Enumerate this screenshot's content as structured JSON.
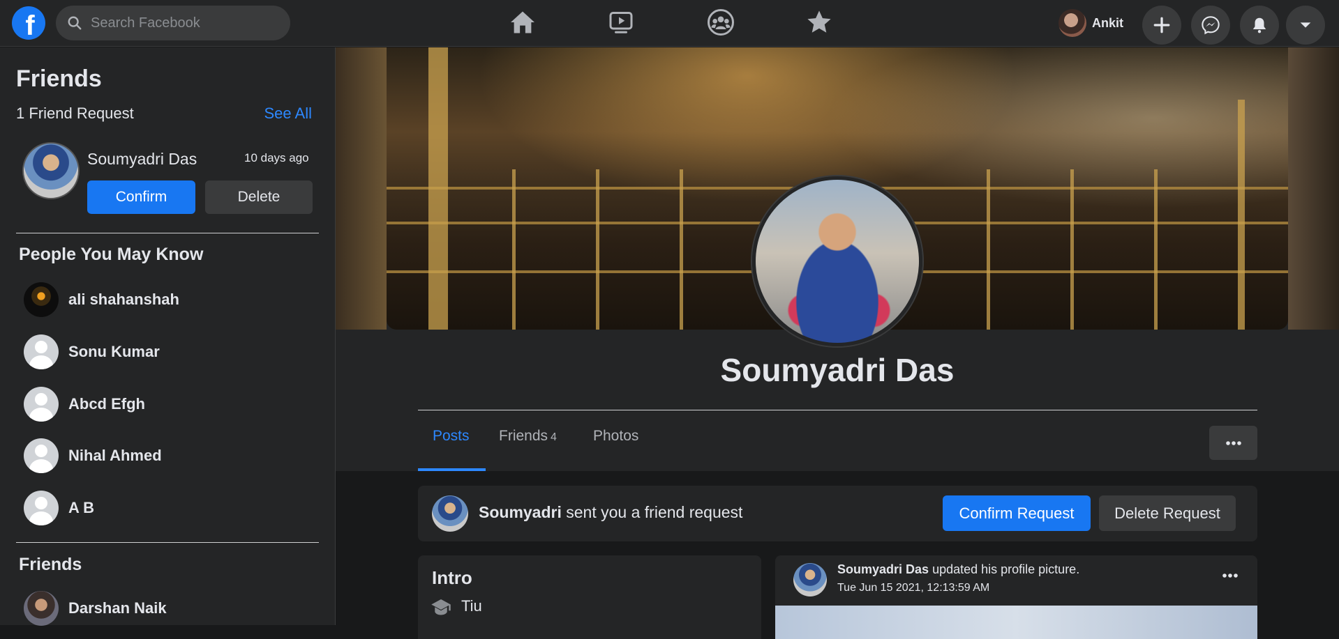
{
  "topbar": {
    "logo": "f",
    "search_placeholder": "Search Facebook",
    "nav_icons": [
      "home-icon",
      "watch-icon",
      "groups-icon",
      "favorites-icon"
    ],
    "user_name": "Ankit",
    "round_buttons": [
      "plus-icon",
      "messenger-icon",
      "bell-icon",
      "caret-down-icon"
    ]
  },
  "sidebar": {
    "title": "Friends",
    "request_count_label": "1 Friend  Request",
    "see_all": "See All",
    "request": {
      "name": "Soumyadri Das",
      "time": "10 days ago",
      "confirm_label": "Confirm",
      "delete_label": "Delete"
    },
    "pymk_title": "People You May Know",
    "pymk": [
      {
        "name": "ali shahanshah"
      },
      {
        "name": "Sonu Kumar"
      },
      {
        "name": "Abcd Efgh"
      },
      {
        "name": "Nihal Ahmed"
      },
      {
        "name": "A B"
      }
    ],
    "friends_title": "Friends",
    "friends": [
      {
        "name": "Darshan Naik"
      }
    ]
  },
  "profile": {
    "name": "Soumyadri Das",
    "tabs": [
      {
        "label": "Posts",
        "active": true
      },
      {
        "label": "Friends",
        "count": "4"
      },
      {
        "label": "Photos"
      }
    ],
    "more_label": "•••"
  },
  "request_banner": {
    "name": "Soumyadri",
    "text": "sent you a friend request",
    "confirm_label": "Confirm Request",
    "delete_label": "Delete Request"
  },
  "intro": {
    "title": "Intro",
    "education": "Tiu"
  },
  "post": {
    "author": "Soumyadri Das",
    "action": "updated his profile picture.",
    "date": "Tue Jun 15 2021, 12:13:59 AM"
  },
  "colors": {
    "accent": "#1877f2",
    "link": "#2d88ff",
    "background": "#18191a",
    "surface": "#242526",
    "button_grey": "#3a3b3c"
  }
}
